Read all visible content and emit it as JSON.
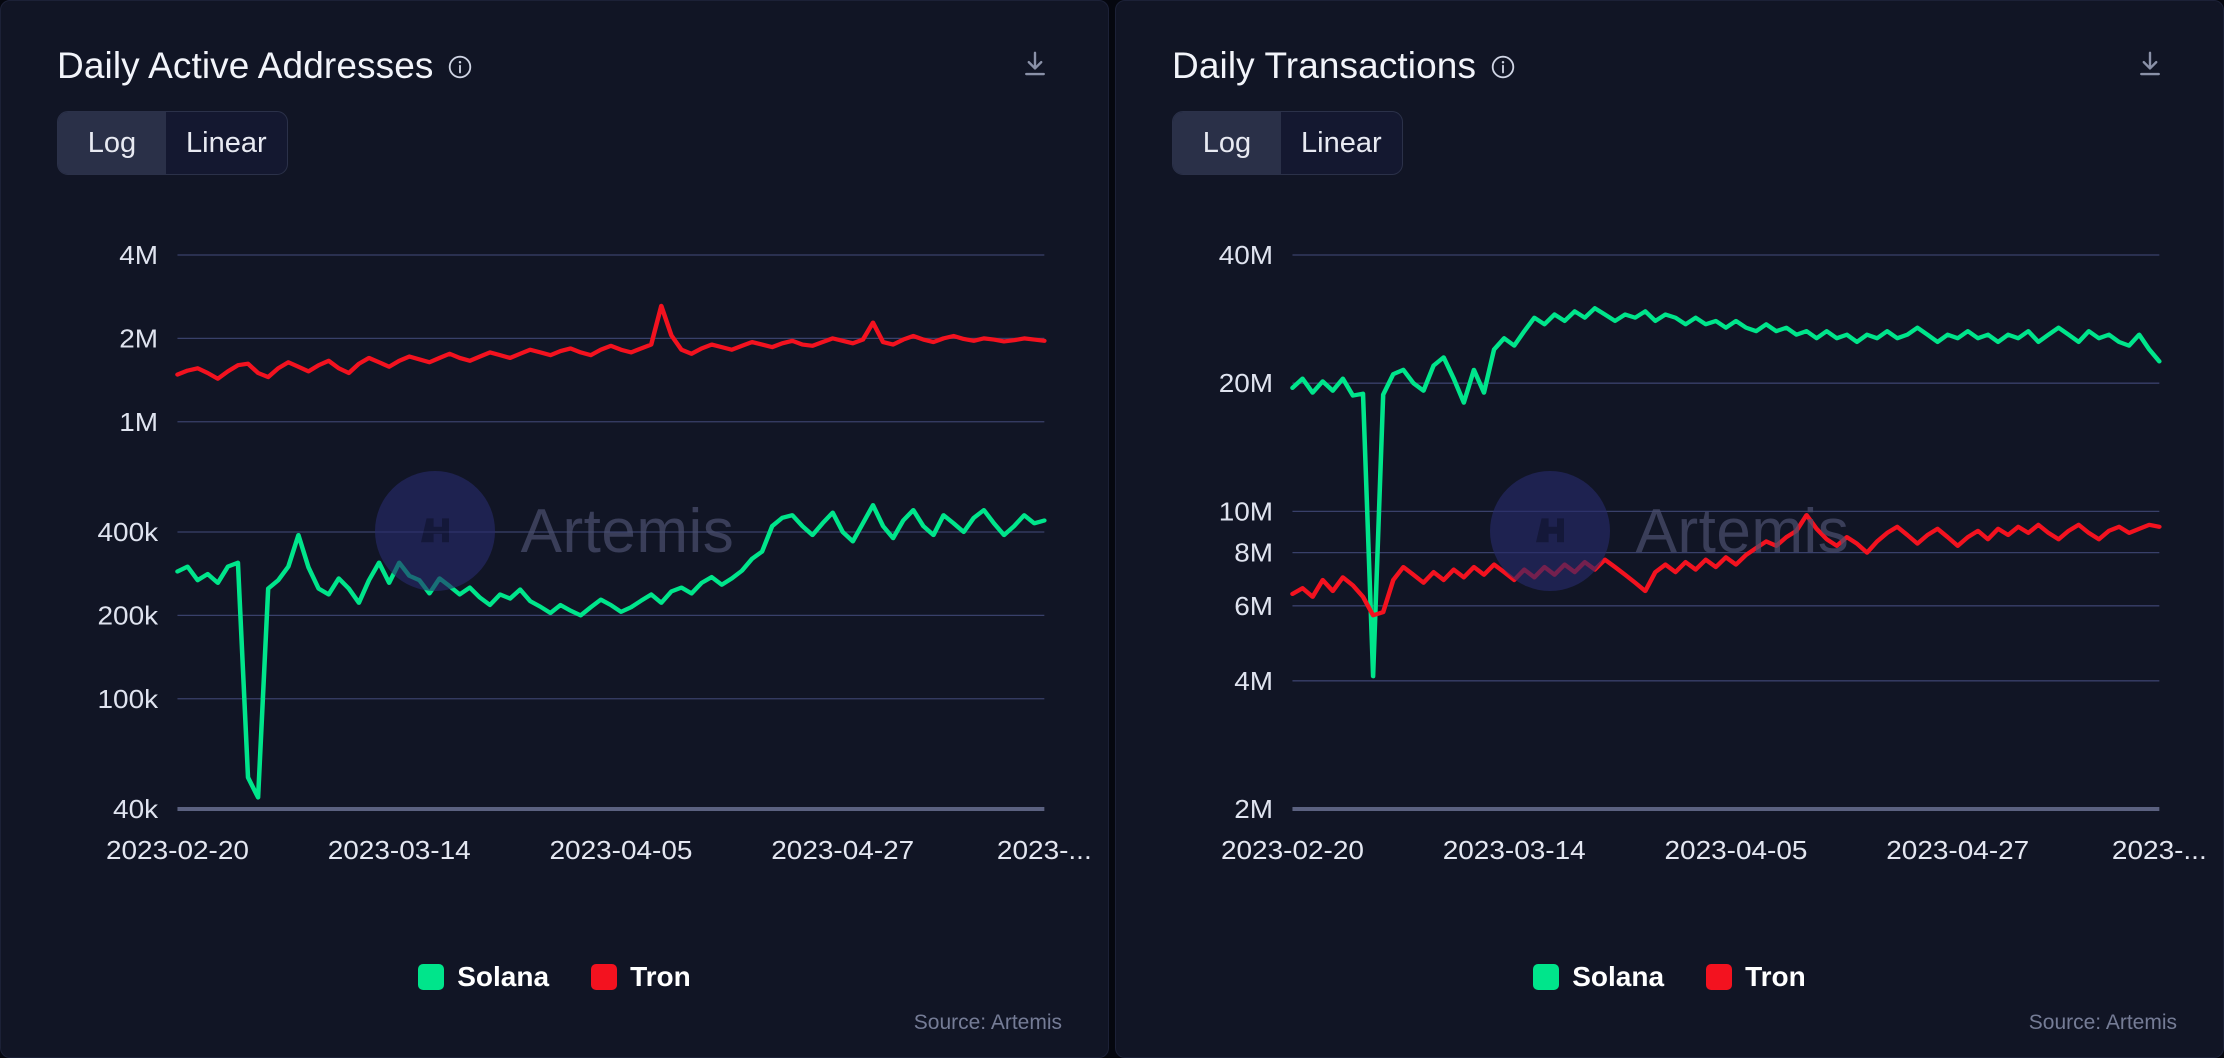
{
  "theme": {
    "background": "#0b0e1a",
    "panel_background": "#111525",
    "panel_border": "#1c2137",
    "grid": "#39406a",
    "text": "#e8eaf2",
    "muted_text": "#757c96",
    "solana_color": "#00E58B",
    "tron_color": "#F3121F",
    "toggle_active_bg": "#2a3048"
  },
  "panels": [
    {
      "id": "daily-active-addresses",
      "title": "Daily Active Addresses",
      "info_icon": "info-circle-icon",
      "download_icon": "download-icon",
      "scale_toggle": {
        "options": [
          "Log",
          "Linear"
        ],
        "selected": "Log"
      },
      "watermark": {
        "text": "Artemis",
        "logo": "artemis-logo-icon"
      },
      "legend": [
        {
          "label": "Solana",
          "color": "#00E58B"
        },
        {
          "label": "Tron",
          "color": "#F3121F"
        }
      ],
      "source": "Source: Artemis",
      "chart_data": {
        "type": "line",
        "title": "Daily Active Addresses",
        "xlabel": "",
        "ylabel": "",
        "yscale": "log",
        "ylim": [
          40000,
          4000000
        ],
        "grid": true,
        "legend_position": "bottom",
        "ytick_labels": [
          "4M",
          "2M",
          "1M",
          "400k",
          "200k",
          "100k",
          "40k"
        ],
        "ytick_values": [
          4000000,
          2000000,
          1000000,
          400000,
          200000,
          100000,
          40000
        ],
        "xtick_labels": [
          "2023-02-20",
          "2023-03-14",
          "2023-04-05",
          "2023-04-27",
          "2023-..."
        ],
        "xtick_positions": [
          0,
          22,
          44,
          66,
          86
        ],
        "x_range": [
          "2023-02-20",
          "2023-05-16"
        ],
        "series": [
          {
            "name": "Solana",
            "color": "#00E58B",
            "values": [
              288000,
              300000,
              268000,
              282000,
              262000,
              300000,
              310000,
              52000,
              44000,
              250000,
              268000,
              300000,
              390000,
              298000,
              250000,
              238000,
              272000,
              250000,
              222000,
              268000,
              310000,
              262000,
              310000,
              278000,
              268000,
              240000,
              272000,
              255000,
              238000,
              252000,
              232000,
              218000,
              238000,
              230000,
              248000,
              225000,
              215000,
              204000,
              218000,
              208000,
              200000,
              214000,
              228000,
              218000,
              206000,
              214000,
              226000,
              238000,
              222000,
              244000,
              252000,
              240000,
              262000,
              275000,
              258000,
              272000,
              290000,
              320000,
              340000,
              420000,
              450000,
              460000,
              420000,
              390000,
              430000,
              470000,
              400000,
              370000,
              430000,
              500000,
              420000,
              380000,
              440000,
              480000,
              420000,
              390000,
              460000,
              430000,
              400000,
              450000,
              480000,
              430000,
              390000,
              420000,
              460000,
              430000,
              440000
            ]
          },
          {
            "name": "Tron",
            "color": "#F3121F",
            "values": [
              1480000,
              1530000,
              1560000,
              1500000,
              1430000,
              1520000,
              1600000,
              1620000,
              1500000,
              1450000,
              1560000,
              1640000,
              1580000,
              1520000,
              1600000,
              1660000,
              1560000,
              1500000,
              1620000,
              1700000,
              1640000,
              1580000,
              1660000,
              1720000,
              1680000,
              1640000,
              1700000,
              1760000,
              1700000,
              1660000,
              1720000,
              1780000,
              1740000,
              1700000,
              1760000,
              1820000,
              1780000,
              1740000,
              1800000,
              1840000,
              1780000,
              1740000,
              1820000,
              1880000,
              1820000,
              1780000,
              1840000,
              1900000,
              2620000,
              2050000,
              1820000,
              1760000,
              1840000,
              1900000,
              1860000,
              1820000,
              1880000,
              1940000,
              1900000,
              1860000,
              1920000,
              1960000,
              1900000,
              1880000,
              1940000,
              2000000,
              1960000,
              1920000,
              1980000,
              2280000,
              1940000,
              1900000,
              1980000,
              2040000,
              1980000,
              1940000,
              2000000,
              2040000,
              1990000,
              1960000,
              2000000,
              1980000,
              1950000,
              1970000,
              2000000,
              1980000,
              1960000
            ]
          }
        ]
      }
    },
    {
      "id": "daily-transactions",
      "title": "Daily Transactions",
      "info_icon": "info-circle-icon",
      "download_icon": "download-icon",
      "scale_toggle": {
        "options": [
          "Log",
          "Linear"
        ],
        "selected": "Log"
      },
      "watermark": {
        "text": "Artemis",
        "logo": "artemis-logo-icon"
      },
      "legend": [
        {
          "label": "Solana",
          "color": "#00E58B"
        },
        {
          "label": "Tron",
          "color": "#F3121F"
        }
      ],
      "source": "Source: Artemis",
      "chart_data": {
        "type": "line",
        "title": "Daily Transactions",
        "xlabel": "",
        "ylabel": "",
        "yscale": "log",
        "ylim": [
          2000000,
          40000000
        ],
        "grid": true,
        "legend_position": "bottom",
        "ytick_labels": [
          "40M",
          "20M",
          "10M",
          "8M",
          "6M",
          "4M",
          "2M"
        ],
        "ytick_values": [
          40000000,
          20000000,
          10000000,
          8000000,
          6000000,
          4000000,
          2000000
        ],
        "xtick_labels": [
          "2023-02-20",
          "2023-03-14",
          "2023-04-05",
          "2023-04-27",
          "2023-..."
        ],
        "xtick_positions": [
          0,
          22,
          44,
          66,
          86
        ],
        "x_range": [
          "2023-02-20",
          "2023-05-16"
        ],
        "series": [
          {
            "name": "Solana",
            "color": "#00E58B",
            "values": [
              19500000,
              20500000,
              19000000,
              20200000,
              19200000,
              20500000,
              18700000,
              18900000,
              4100000,
              18800000,
              21000000,
              21500000,
              20000000,
              19200000,
              22000000,
              23000000,
              20500000,
              18000000,
              21500000,
              19000000,
              24000000,
              25500000,
              24500000,
              26500000,
              28500000,
              27500000,
              29000000,
              28000000,
              29500000,
              28500000,
              30000000,
              29000000,
              28000000,
              29000000,
              28500000,
              29500000,
              28000000,
              29000000,
              28500000,
              27500000,
              28500000,
              27500000,
              28000000,
              27000000,
              28000000,
              27000000,
              26500000,
              27500000,
              26500000,
              27000000,
              26000000,
              26500000,
              25500000,
              26500000,
              25500000,
              26000000,
              25000000,
              26000000,
              25500000,
              26500000,
              25500000,
              26000000,
              27000000,
              26000000,
              25000000,
              26000000,
              25500000,
              26500000,
              25500000,
              26000000,
              25000000,
              26000000,
              25500000,
              26500000,
              25000000,
              26000000,
              27000000,
              26000000,
              25000000,
              26500000,
              25500000,
              26000000,
              25000000,
              24500000,
              26000000,
              24000000,
              22500000
            ]
          },
          {
            "name": "Tron",
            "color": "#F3121F",
            "values": [
              6400000,
              6600000,
              6300000,
              6900000,
              6500000,
              7000000,
              6700000,
              6300000,
              5700000,
              5800000,
              6900000,
              7400000,
              7100000,
              6800000,
              7200000,
              6900000,
              7300000,
              7000000,
              7400000,
              7100000,
              7500000,
              7200000,
              6900000,
              7300000,
              7000000,
              7400000,
              7100000,
              7500000,
              7200000,
              7600000,
              7300000,
              7700000,
              7400000,
              7100000,
              6800000,
              6500000,
              7200000,
              7500000,
              7200000,
              7600000,
              7300000,
              7700000,
              7400000,
              7800000,
              7500000,
              7900000,
              8200000,
              8500000,
              8300000,
              8700000,
              9000000,
              9800000,
              9100000,
              8600000,
              8300000,
              8700000,
              8400000,
              8000000,
              8500000,
              8900000,
              9200000,
              8800000,
              8400000,
              8800000,
              9100000,
              8700000,
              8300000,
              8700000,
              9000000,
              8600000,
              9100000,
              8800000,
              9200000,
              8900000,
              9300000,
              8900000,
              8600000,
              9000000,
              9300000,
              8900000,
              8600000,
              9000000,
              9200000,
              8900000,
              9100000,
              9300000,
              9200000
            ]
          }
        ]
      }
    }
  ]
}
